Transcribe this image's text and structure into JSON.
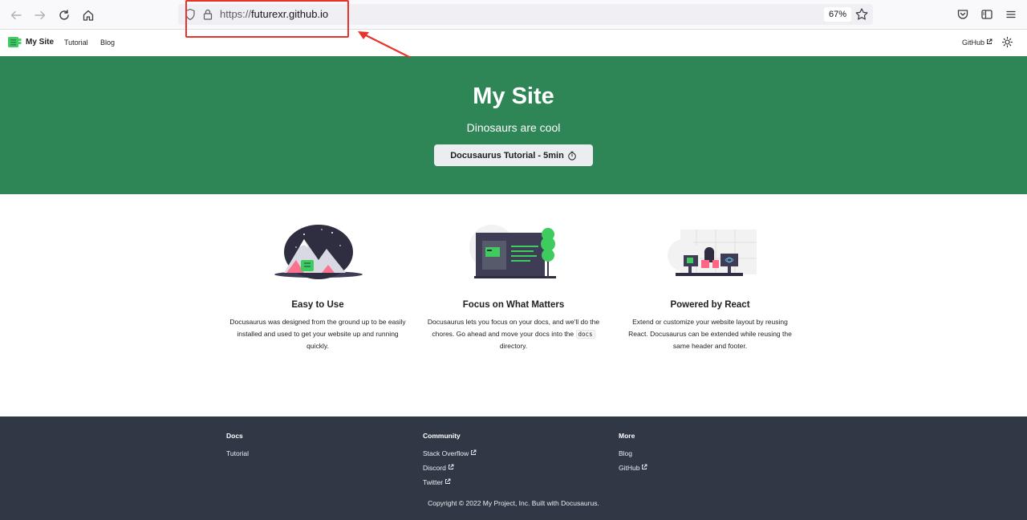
{
  "browser": {
    "url_scheme": "https://",
    "url_host": "futurexr.github.io",
    "zoom": "67%"
  },
  "navbar": {
    "title": "My Site",
    "links": [
      "Tutorial",
      "Blog"
    ],
    "github_label": "GitHub"
  },
  "hero": {
    "title": "My Site",
    "subtitle": "Dinosaurs are cool",
    "button_label": "Docusaurus Tutorial - 5min"
  },
  "features": [
    {
      "title": "Easy to Use",
      "desc": "Docusaurus was designed from the ground up to be easily installed and used to get your website up and running quickly."
    },
    {
      "title": "Focus on What Matters",
      "desc_before": "Docusaurus lets you focus on your docs, and we'll do the chores. Go ahead and move your docs into the",
      "desc_code": "docs",
      "desc_after": "directory."
    },
    {
      "title": "Powered by React",
      "desc": "Extend or customize your website layout by reusing React. Docusaurus can be extended while reusing the same header and footer."
    }
  ],
  "footer": {
    "columns": [
      {
        "title": "Docs",
        "links": [
          "Tutorial"
        ]
      },
      {
        "title": "Community",
        "links": [
          "Stack Overflow",
          "Discord",
          "Twitter"
        ]
      },
      {
        "title": "More",
        "links": [
          "Blog",
          "GitHub"
        ]
      }
    ],
    "copyright": "Copyright © 2022 My Project, Inc. Built with Docusaurus."
  },
  "colors": {
    "primary": "#2e8555",
    "footer_bg": "#303846",
    "annotation": "#e8322c"
  }
}
